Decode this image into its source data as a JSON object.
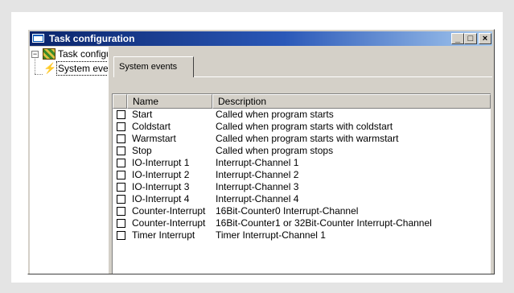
{
  "window": {
    "title": "Task configuration",
    "minimize_glyph": "_",
    "maximize_glyph": "□",
    "close_glyph": "×"
  },
  "tree": {
    "expander_glyph": "−",
    "items": [
      {
        "label": "Task configuration",
        "icon": "task-config-icon"
      },
      {
        "label": "System events",
        "icon": "lightning-icon"
      }
    ]
  },
  "tabs": [
    {
      "label": "System events"
    }
  ],
  "table": {
    "columns": [
      "Name",
      "Description"
    ],
    "rows": [
      {
        "name": "Start",
        "description": "Called when program starts"
      },
      {
        "name": "Coldstart",
        "description": "Called when program starts with coldstart"
      },
      {
        "name": "Warmstart",
        "description": "Called when program starts with warmstart"
      },
      {
        "name": "Stop",
        "description": "Called when program stops"
      },
      {
        "name": "IO-Interrupt 1",
        "description": "Interrupt-Channel 1"
      },
      {
        "name": "IO-Interrupt 2",
        "description": "Interrupt-Channel 2"
      },
      {
        "name": "IO-Interrupt 3",
        "description": "Interrupt-Channel 3"
      },
      {
        "name": "IO-Interrupt 4",
        "description": "Interrupt-Channel 4"
      },
      {
        "name": "Counter-Interrupt",
        "description": "16Bit-Counter0 Interrupt-Channel"
      },
      {
        "name": "Counter-Interrupt",
        "description": "16Bit-Counter1 or 32Bit-Counter Interrupt-Channel"
      },
      {
        "name": "Timer Interrupt",
        "description": "Timer Interrupt-Channel 1"
      }
    ]
  },
  "colors": {
    "titlebar_start": "#0a246a",
    "titlebar_end": "#a6caf0",
    "dialog_face": "#d4d0c8",
    "page_background": "#e4e4e4"
  }
}
